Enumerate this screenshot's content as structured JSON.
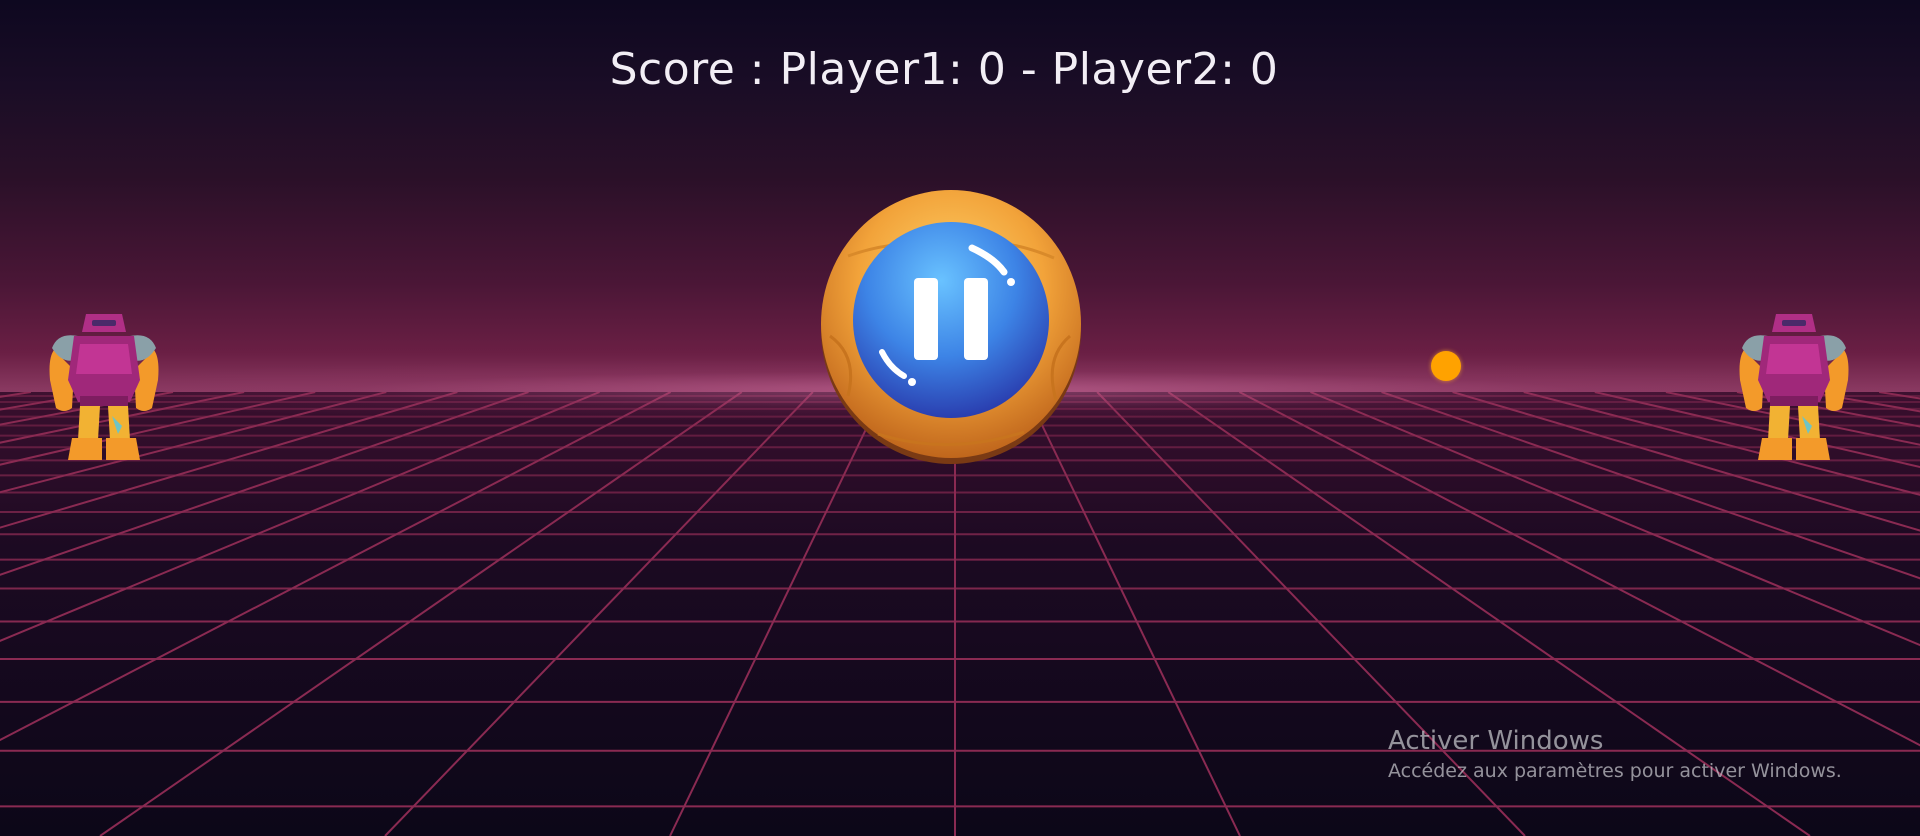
{
  "hud": {
    "score_text": "Score : Player1: 0 - Player2: 0"
  },
  "game": {
    "player1": {
      "score": 0,
      "sprite": "robot-icon"
    },
    "player2": {
      "score": 0,
      "sprite": "robot-icon"
    },
    "ball": {
      "color": "#ffa200"
    },
    "pause_button": {
      "icon": "pause-icon"
    }
  },
  "watermark": {
    "title": "Activer Windows",
    "subtitle": "Accédez aux paramètres pour activer Windows."
  },
  "colors": {
    "sky_top": "#0e0820",
    "horizon": "#8a3a62",
    "grid_line": "#8a2a52",
    "floor_bottom": "#0c0718",
    "button_rim": "#f2a33a",
    "button_face": "#3d84e6"
  }
}
